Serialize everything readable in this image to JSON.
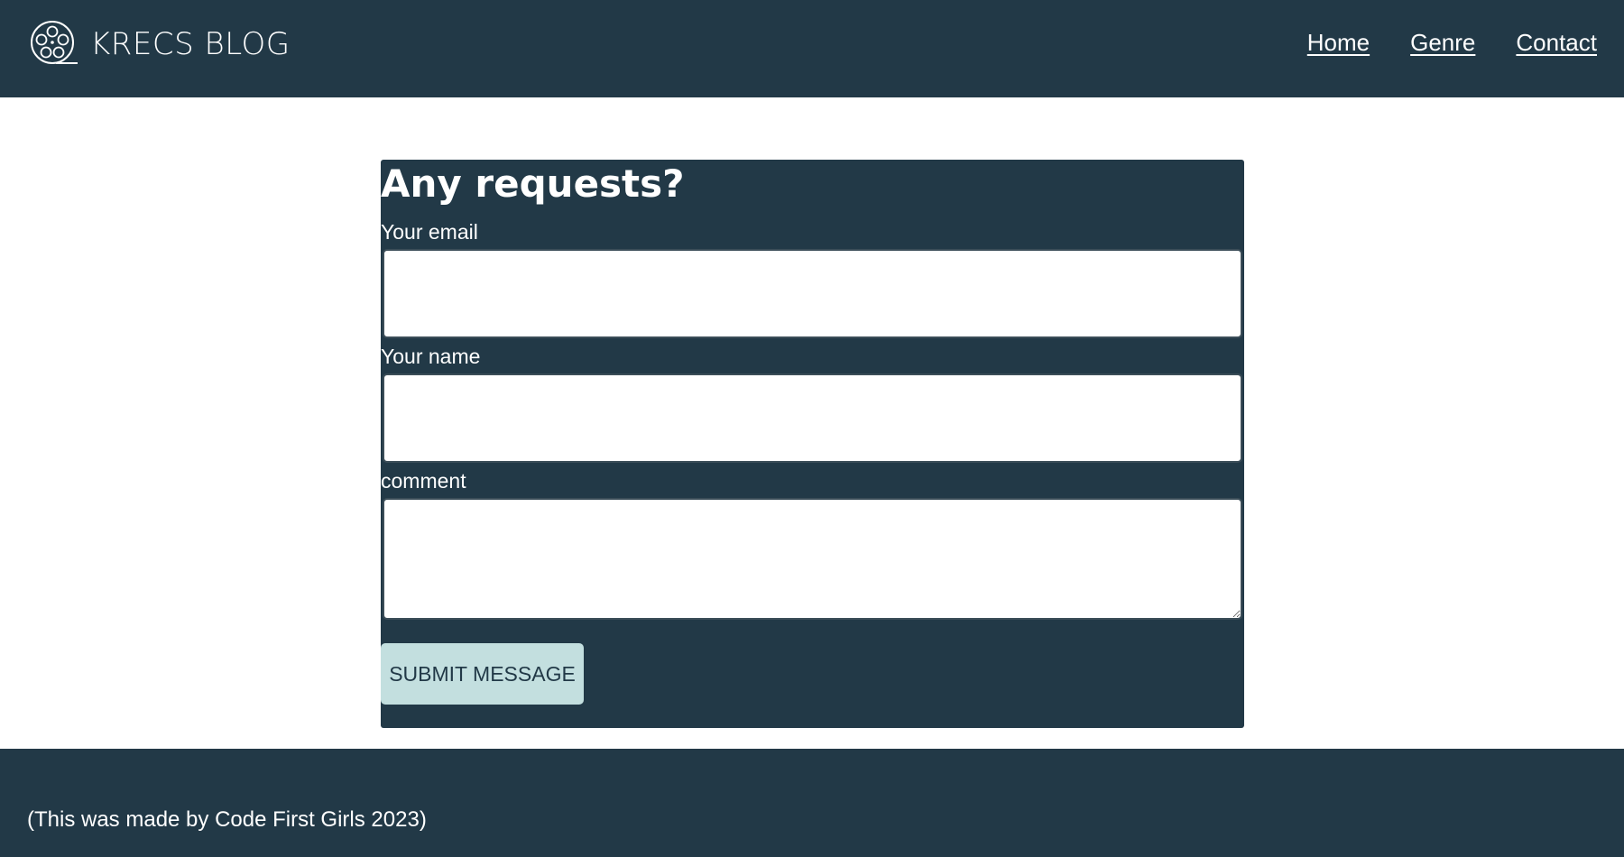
{
  "header": {
    "brand_title": "KRECS BLOG",
    "logo_icon": "film-reel-icon",
    "nav": [
      {
        "label": "Home"
      },
      {
        "label": "Genre"
      },
      {
        "label": "Contact"
      }
    ]
  },
  "form": {
    "title": "Any requests?",
    "email_label": "Your email",
    "email_value": "",
    "name_label": "Your name",
    "name_value": "",
    "comment_label": "comment",
    "comment_value": "",
    "submit_label": "SUBMIT MESSAGE"
  },
  "footer": {
    "text": "(This was made by Code First Girls 2023)"
  },
  "colors": {
    "header_bg": "#223947",
    "button_bg": "#c3dfdf",
    "page_bg": "#ffffff"
  }
}
